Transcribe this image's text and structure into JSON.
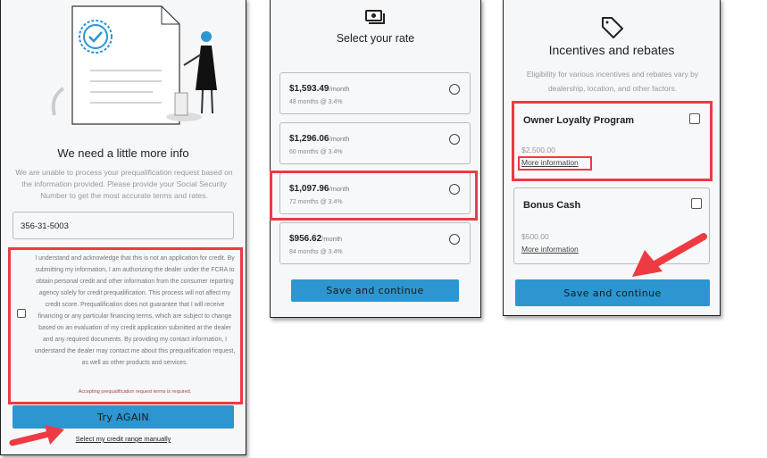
{
  "panel1": {
    "title": "We need a little more info",
    "description": "We are unable to process your prequalification request based on the information provided. Please provide your Social Security Number to get the most accurate terms and rates.",
    "ssn_value": "356-31-5003",
    "consent_text": "I understand and acknowledge that this is not an application for credit. By submitting my information, I am authorizing the dealer under the FCRA to obtain personal credit and other information from the consumer reporting agency solely for credit prequalification. This process will not affect my credit score. Prequalification does not guarantee that I will receive financing or any particular financing terms, which are subject to change based on an evaluation of my credit application submitted at the dealer and any required documents. By providing my contact information, I understand the dealer may contact me about this prequalification request, as well as other products and services.",
    "error_text": "Accepting prequalification request terms is required.",
    "button_label": "Try AGAIN",
    "manual_link": "Select my credit range manually"
  },
  "panel2": {
    "icon": "cash-icon",
    "title": "Select your rate",
    "rates": [
      {
        "amount": "$1,593.49",
        "unit": "/month",
        "terms": "48 months @ 3.4%"
      },
      {
        "amount": "$1,296.06",
        "unit": "/month",
        "terms": "60 months @ 3.4%"
      },
      {
        "amount": "$1,097.96",
        "unit": "/month",
        "terms": "72 months @ 3.4%"
      },
      {
        "amount": "$956.62",
        "unit": "/month",
        "terms": "84 months @ 3.4%"
      }
    ],
    "button_label": "Save and continue"
  },
  "panel3": {
    "icon": "tag-icon",
    "title": "Incentives and rebates",
    "description": "Eligibility for various incentives and rebates vary by dealership, location, and other factors.",
    "incentives": [
      {
        "name": "Owner Loyalty Program",
        "amount": "$2,500.00",
        "link": "More information"
      },
      {
        "name": "Bonus Cash",
        "amount": "$500.00",
        "link": "More information"
      }
    ],
    "button_label": "Save and continue"
  },
  "colors": {
    "accent": "#2d95cf",
    "highlight": "#ee3a43",
    "panel_bg": "#f6f7f9"
  }
}
